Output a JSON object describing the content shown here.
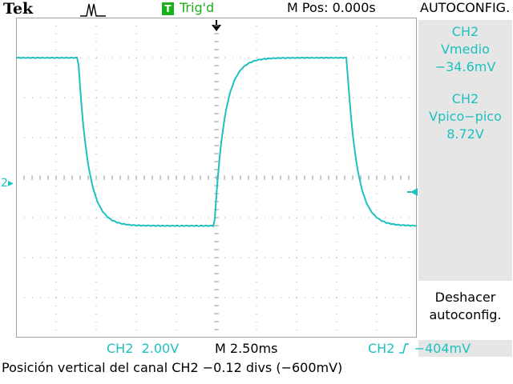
{
  "header": {
    "brand": "Tek",
    "acquisition_icon": "run-pulse-icon",
    "trigger_badge": "T",
    "trigger_status": "Trig'd",
    "horizontal_position": "M Pos: 0.000s",
    "menu_title": "AUTOCONFIG."
  },
  "side_menu": {
    "measure1": {
      "source": "CH2",
      "label": "Vmedio",
      "value": "−34.6mV"
    },
    "measure2": {
      "source": "CH2",
      "label": "Vpico−pico",
      "value": "8.72V"
    },
    "undo_line1": "Deshacer",
    "undo_line2": "autoconfig."
  },
  "display": {
    "channel_marker": "2",
    "colors": {
      "trace": "#1ec0c0",
      "grid": "#a0a0a0",
      "trigger": "#19b019",
      "menu_bg": "#e6e6e6"
    },
    "waveform": {
      "type": "square",
      "divisions": {
        "x": 10,
        "y": 8
      },
      "high_level_div": 3.0,
      "low_level_div": -1.2,
      "edges_div": [
        {
          "dir": "fall",
          "at": 1.55
        },
        {
          "dir": "rise",
          "at": 4.95
        },
        {
          "dir": "fall",
          "at": 8.25
        }
      ]
    }
  },
  "footer": {
    "ch2_label": "CH2",
    "ch2_scale": "2.00V",
    "timebase": "M 2.50ms",
    "trigger_source": "CH2",
    "trigger_level": "−404mV",
    "status_message": "Posición vertical del canal CH2 −0.12 divs (−600mV)"
  }
}
